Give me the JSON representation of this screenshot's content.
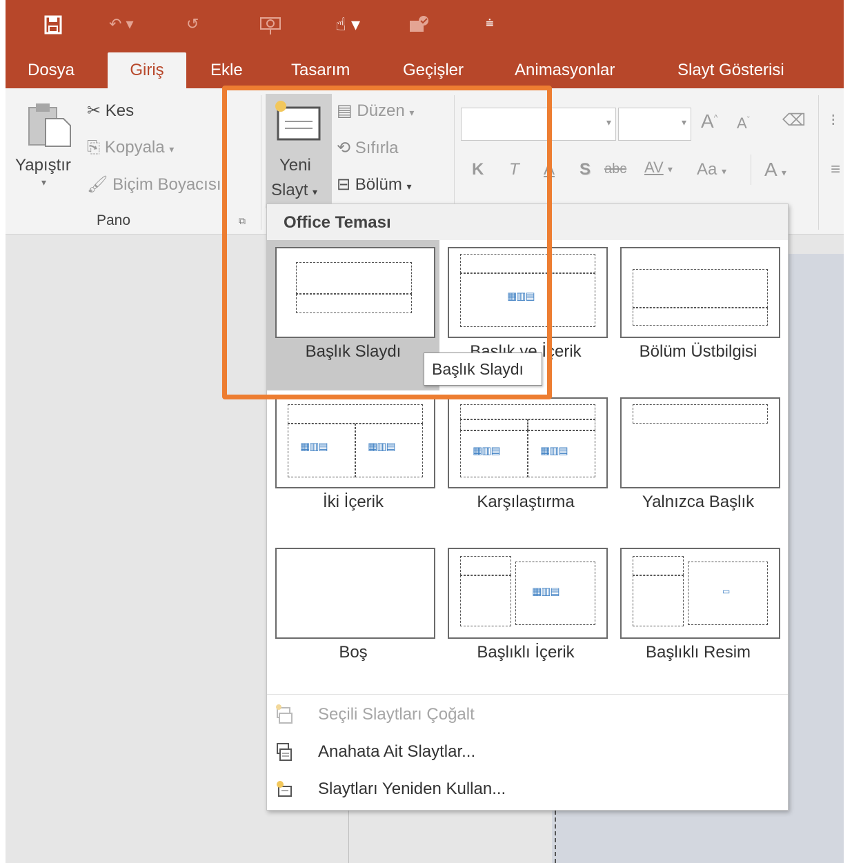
{
  "quick_access": {
    "icons": [
      "save-icon",
      "undo-icon",
      "redo-icon",
      "presenter-icon",
      "touch-mode-icon",
      "accessibility-icon",
      "customize-icon"
    ]
  },
  "tabs": [
    {
      "label": "Dosya"
    },
    {
      "label": "Giriş"
    },
    {
      "label": "Ekle"
    },
    {
      "label": "Tasarım"
    },
    {
      "label": "Geçişler"
    },
    {
      "label": "Animasyonlar"
    },
    {
      "label": "Slayt Gösterisi"
    }
  ],
  "ribbon": {
    "clipboard": {
      "paste": "Yapıştır",
      "cut": "Kes",
      "copy": "Kopyala",
      "format_painter": "Biçim Boyacısı",
      "group_label": "Pano"
    },
    "slides": {
      "new_slide_line1": "Yeni",
      "new_slide_line2": "Slayt",
      "layout": "Düzen",
      "reset": "Sıfırla",
      "section": "Bölüm"
    },
    "font": {
      "bold": "K",
      "italic": "T",
      "underline": "A",
      "shadow": "S",
      "strike": "abc",
      "spacing": "AV",
      "case": "Aa",
      "grow": "A",
      "shrink": "A",
      "color": "A"
    }
  },
  "dropdown": {
    "header": "Office Teması",
    "layouts": [
      {
        "label": "Başlık Slaydı",
        "selected": true
      },
      {
        "label": "Başlık ve İçerik"
      },
      {
        "label": "Bölüm Üstbilgisi"
      },
      {
        "label": "İki İçerik"
      },
      {
        "label": "Karşılaştırma"
      },
      {
        "label": "Yalnızca Başlık"
      },
      {
        "label": "Boş"
      },
      {
        "label": "Başlıklı İçerik"
      },
      {
        "label": "Başlıklı Resim"
      }
    ],
    "menu": [
      {
        "label": "Seçili Slaytları Çoğalt",
        "disabled": true
      },
      {
        "label": "Anahata Ait Slaytlar..."
      },
      {
        "label": "Slaytları Yeniden Kullan..."
      }
    ],
    "tooltip": "Başlık Slaydı"
  },
  "colors": {
    "accent": "#b7472a",
    "highlight": "#ed7d31"
  }
}
